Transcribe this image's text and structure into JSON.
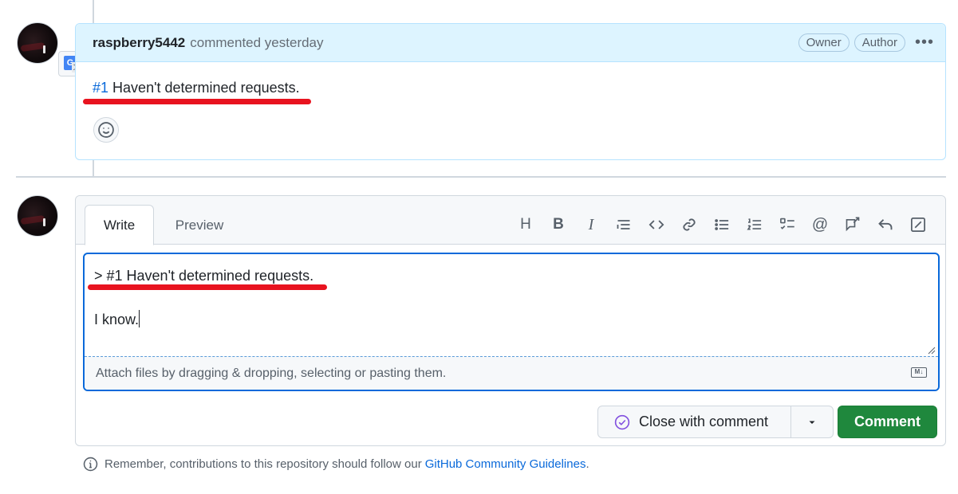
{
  "comment": {
    "author": "raspberry5442",
    "meta": "commented yesterday",
    "labels": [
      "Owner",
      "Author"
    ],
    "menu_icon": "kebab-horizontal-icon",
    "body_ref": "#1",
    "body_text": "Haven't determined requests.",
    "reaction_icon": "smiley-icon",
    "translate_letters": {
      "g": "G",
      "x": "文"
    }
  },
  "editor": {
    "tabs": [
      "Write",
      "Preview"
    ],
    "toolbar_icons": [
      "heading-icon",
      "bold-icon",
      "italic-icon",
      "quote-icon",
      "code-icon",
      "link-icon",
      "unordered-list-icon",
      "ordered-list-icon",
      "task-list-icon",
      "mention-icon",
      "cross-reference-icon",
      "reply-icon",
      "fullscreen-icon"
    ],
    "toolbar_h": "H",
    "toolbar_b": "B",
    "toolbar_i": "I",
    "toolbar_at": "@",
    "line1": "> #1 Haven't determined requests.",
    "line3": "I know.",
    "attach_text": "Attach files by dragging & dropping, selecting or pasting them.",
    "markdown_icon": "markdown-icon",
    "markdown_letters": "M↓"
  },
  "actions": {
    "close_label": "Close with comment",
    "comment_label": "Comment"
  },
  "footer": {
    "text": "Remember, contributions to this repository should follow our",
    "link": "GitHub Community Guidelines",
    "period": "."
  },
  "colors": {
    "accent_blue": "#0969da",
    "header_bg": "#ddf4ff",
    "highlight_red": "#e8131f",
    "comment_green": "#1f883d",
    "close_purple": "#8250df"
  }
}
